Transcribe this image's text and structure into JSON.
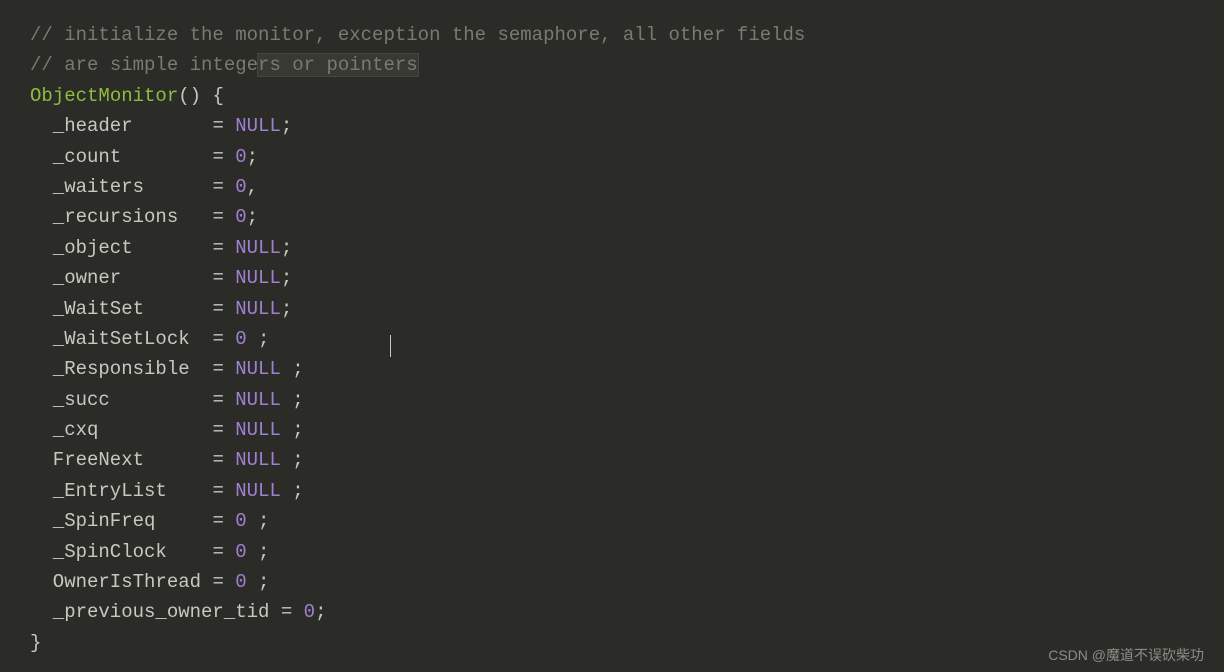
{
  "comment_lines": [
    "// initialize the monitor, exception the semaphore, all other fields",
    "// are simple integers or pointers"
  ],
  "highlight_fragment": "rs or·pointers",
  "func": {
    "name": "ObjectMonitor",
    "open_paren": "(",
    "close_paren": ")",
    "open_brace": " {",
    "close_brace": "}"
  },
  "fields": [
    {
      "name": "_header",
      "pad": "       ",
      "op": "= ",
      "val": "NULL",
      "term": ";"
    },
    {
      "name": "_count",
      "pad": "        ",
      "op": "= ",
      "val": "0",
      "term": ";"
    },
    {
      "name": "_waiters",
      "pad": "      ",
      "op": "= ",
      "val": "0",
      "term": ","
    },
    {
      "name": "_recursions",
      "pad": "   ",
      "op": "= ",
      "val": "0",
      "term": ";"
    },
    {
      "name": "_object",
      "pad": "       ",
      "op": "= ",
      "val": "NULL",
      "term": ";"
    },
    {
      "name": "_owner",
      "pad": "        ",
      "op": "= ",
      "val": "NULL",
      "term": ";"
    },
    {
      "name": "_WaitSet",
      "pad": "      ",
      "op": "= ",
      "val": "NULL",
      "term": ";"
    },
    {
      "name": "_WaitSetLock",
      "pad": "  ",
      "op": "= ",
      "val": "0",
      "term": " ;"
    },
    {
      "name": "_Responsible",
      "pad": "  ",
      "op": "= ",
      "val": "NULL",
      "term": " ;"
    },
    {
      "name": "_succ",
      "pad": "         ",
      "op": "= ",
      "val": "NULL",
      "term": " ;"
    },
    {
      "name": "_cxq",
      "pad": "          ",
      "op": "= ",
      "val": "NULL",
      "term": " ;"
    },
    {
      "name": "FreeNext",
      "pad": "      ",
      "op": "= ",
      "val": "NULL",
      "term": " ;"
    },
    {
      "name": "_EntryList",
      "pad": "    ",
      "op": "= ",
      "val": "NULL",
      "term": " ;"
    },
    {
      "name": "_SpinFreq",
      "pad": "     ",
      "op": "= ",
      "val": "0",
      "term": " ;"
    },
    {
      "name": "_SpinClock",
      "pad": "    ",
      "op": "= ",
      "val": "0",
      "term": " ;"
    },
    {
      "name": "OwnerIsThread",
      "pad": " ",
      "op": "= ",
      "val": "0",
      "term": " ;"
    },
    {
      "name": "_previous_owner_tid",
      "pad": " ",
      "op": "= ",
      "val": "0",
      "term": ";"
    }
  ],
  "watermark": "CSDN @魔道不误砍柴功"
}
